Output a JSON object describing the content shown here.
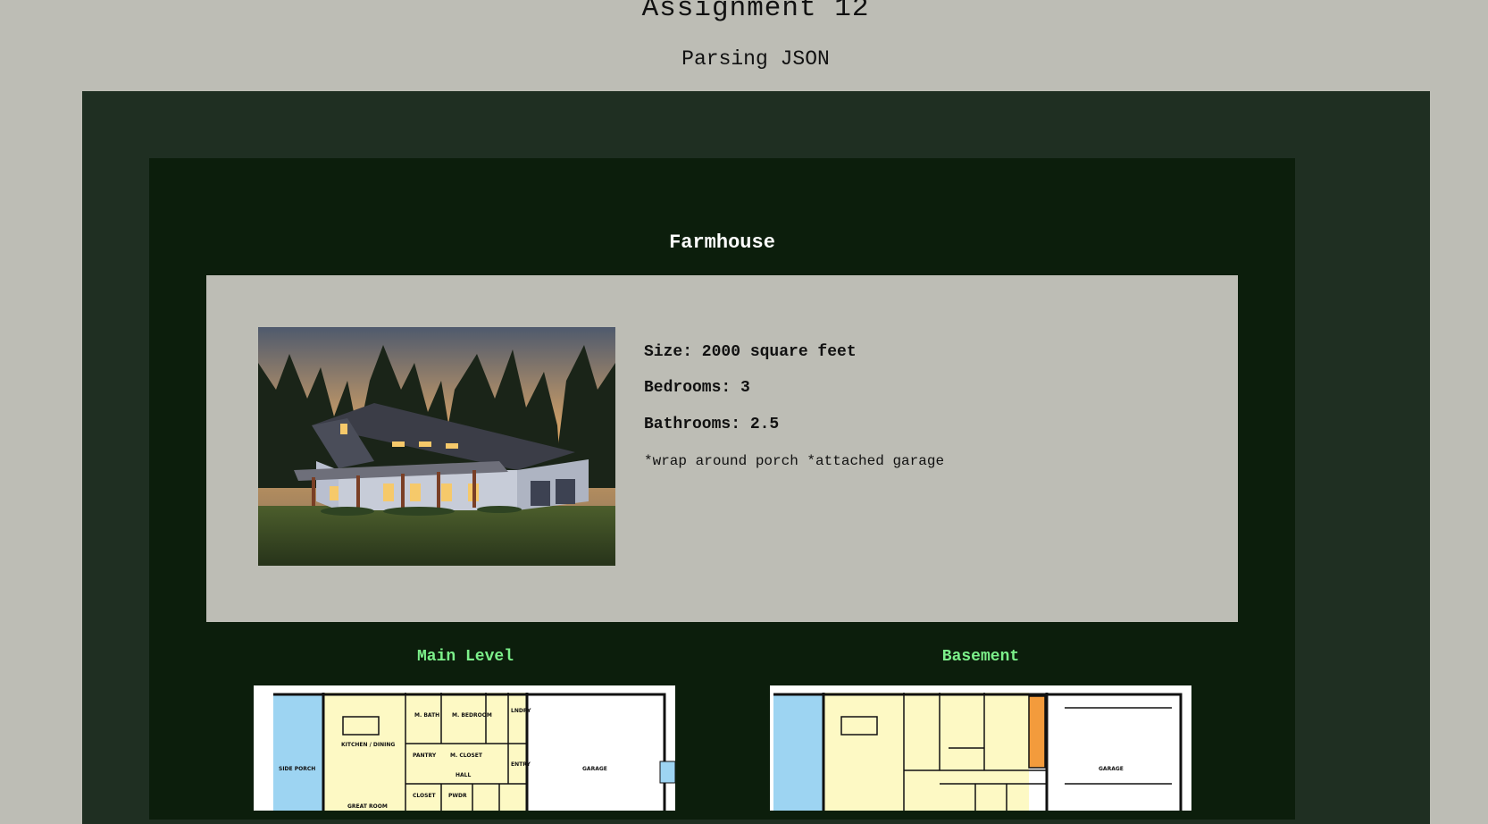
{
  "header": {
    "title": "Assignment 12",
    "subtitle": "Parsing JSON"
  },
  "house": {
    "name": "Farmhouse",
    "size_text": "Size: 2000 square feet",
    "bedrooms_text": "Bedrooms: 3",
    "bathrooms_text": "Bathrooms: 2.5",
    "features_text": "*wrap around porch *attached garage",
    "photo_icon": "farmhouse-photo"
  },
  "plans": {
    "main": {
      "label": "Main Level",
      "rooms": {
        "side_porch": "SIDE PORCH",
        "kitchen": "KITCHEN / DINING",
        "bath": "M. BATH",
        "bedroom": "M. BEDROOM",
        "pantry": "PANTRY",
        "closet": "M. CLOSET",
        "hall": "HALL",
        "laundry": "LNDRY",
        "entry": "ENTRY",
        "garage": "GARAGE",
        "great_room": "GREAT ROOM",
        "closet_small": "CLOSET",
        "powder": "PWDR"
      }
    },
    "basement": {
      "label": "Basement",
      "rooms": {
        "garage": "GARAGE"
      }
    }
  },
  "colors": {
    "page_bg": "#bdbdb5",
    "outer_panel": "#1f2f22",
    "inner_panel": "#0c1e0c",
    "title_white": "#ffffff",
    "plan_label": "#7cf08a",
    "plan_yellow": "#fdf9c4",
    "plan_blue": "#9dd4f2",
    "plan_orange": "#f39b3c"
  }
}
